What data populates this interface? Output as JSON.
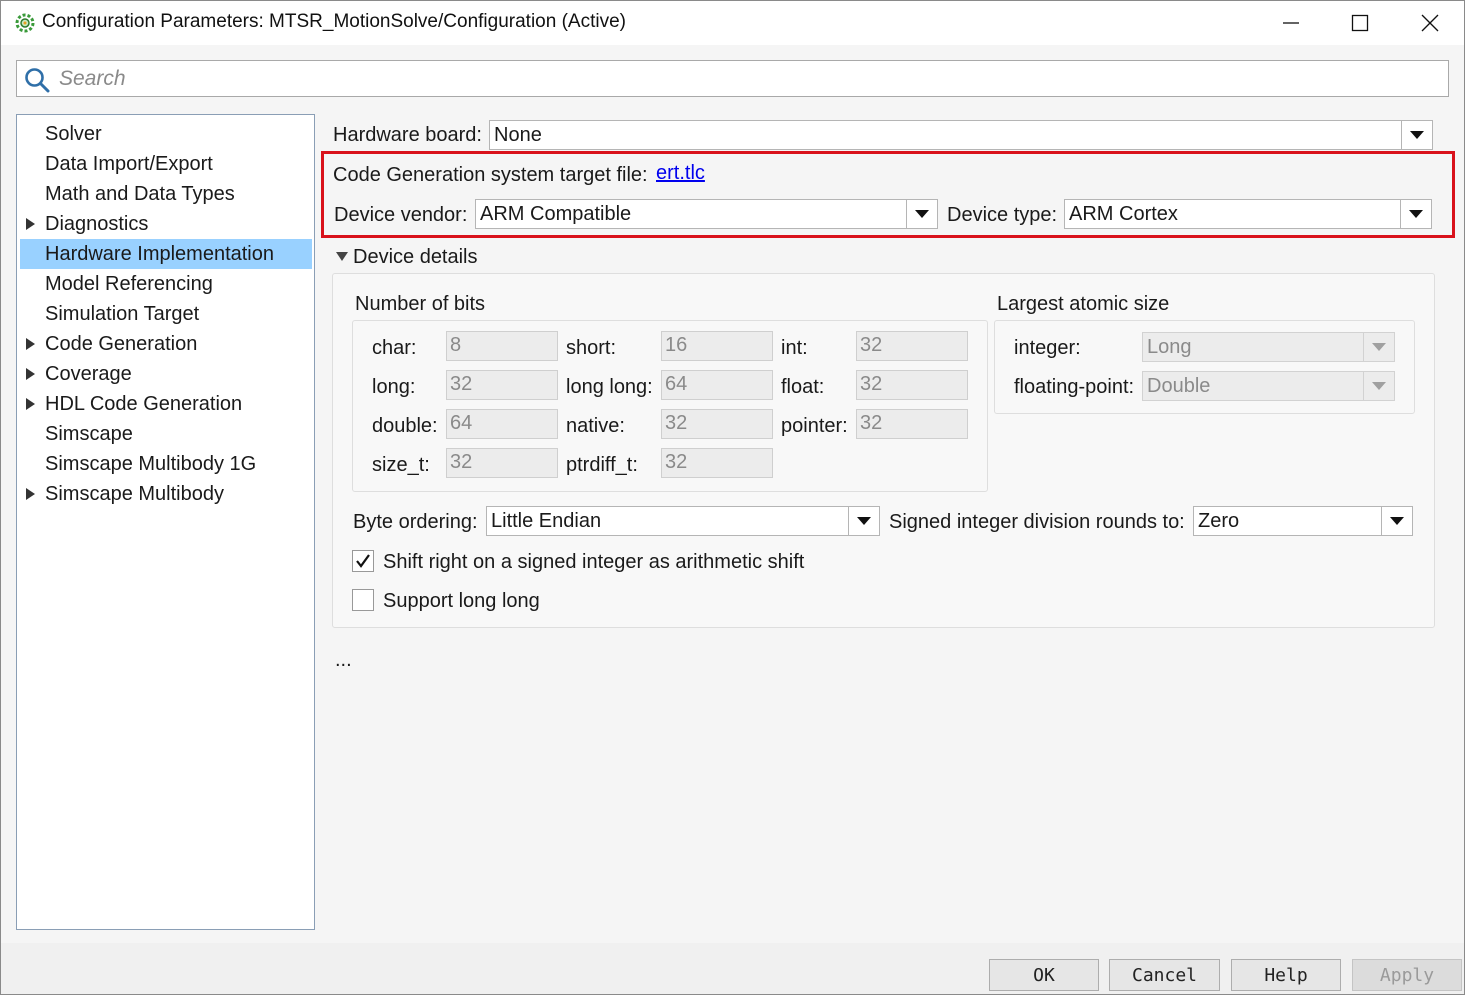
{
  "window": {
    "title": "Configuration Parameters: MTSR_MotionSolve/Configuration (Active)"
  },
  "search": {
    "placeholder": "Search"
  },
  "tree": {
    "items": [
      {
        "label": "Solver",
        "expandable": false,
        "selected": false
      },
      {
        "label": "Data Import/Export",
        "expandable": false,
        "selected": false
      },
      {
        "label": "Math and Data Types",
        "expandable": false,
        "selected": false
      },
      {
        "label": "Diagnostics",
        "expandable": true,
        "selected": false
      },
      {
        "label": "Hardware Implementation",
        "expandable": false,
        "selected": true
      },
      {
        "label": "Model Referencing",
        "expandable": false,
        "selected": false
      },
      {
        "label": "Simulation Target",
        "expandable": false,
        "selected": false
      },
      {
        "label": "Code Generation",
        "expandable": true,
        "selected": false
      },
      {
        "label": "Coverage",
        "expandable": true,
        "selected": false
      },
      {
        "label": "HDL Code Generation",
        "expandable": true,
        "selected": false
      },
      {
        "label": "Simscape",
        "expandable": false,
        "selected": false
      },
      {
        "label": "Simscape Multibody 1G",
        "expandable": false,
        "selected": false
      },
      {
        "label": "Simscape Multibody",
        "expandable": true,
        "selected": false
      }
    ]
  },
  "hardware": {
    "board_label": "Hardware board:",
    "board_value": "None",
    "target_file_label": "Code Generation system target file:",
    "target_file_link": "ert.tlc",
    "vendor_label": "Device vendor:",
    "vendor_value": "ARM Compatible",
    "type_label": "Device type:",
    "type_value": "ARM Cortex"
  },
  "details": {
    "section_label": "Device details",
    "bits_title": "Number of bits",
    "bits": {
      "char": {
        "label": "char:",
        "value": "8"
      },
      "short": {
        "label": "short:",
        "value": "16"
      },
      "int": {
        "label": "int:",
        "value": "32"
      },
      "long": {
        "label": "long:",
        "value": "32"
      },
      "long_long": {
        "label": "long long:",
        "value": "64"
      },
      "float": {
        "label": "float:",
        "value": "32"
      },
      "double": {
        "label": "double:",
        "value": "64"
      },
      "native": {
        "label": "native:",
        "value": "32"
      },
      "pointer": {
        "label": "pointer:",
        "value": "32"
      },
      "size_t": {
        "label": "size_t:",
        "value": "32"
      },
      "ptrdiff_t": {
        "label": "ptrdiff_t:",
        "value": "32"
      }
    },
    "atomic_title": "Largest atomic size",
    "atomic": {
      "integer_label": "integer:",
      "integer_value": "Long",
      "float_label": "floating-point:",
      "float_value": "Double"
    },
    "byte_ordering_label": "Byte ordering:",
    "byte_ordering_value": "Little Endian",
    "signed_div_label": "Signed integer division rounds to:",
    "signed_div_value": "Zero",
    "shift_right_label": "Shift right on a signed integer as arithmetic shift",
    "shift_right_checked": true,
    "support_long_long_label": "Support long long",
    "support_long_long_checked": false
  },
  "ellipsis": "...",
  "buttons": {
    "ok": "OK",
    "cancel": "Cancel",
    "help": "Help",
    "apply": "Apply"
  },
  "colors": {
    "selection": "#99d1ff",
    "highlight_border": "#d9121b",
    "link": "#0000ee"
  }
}
